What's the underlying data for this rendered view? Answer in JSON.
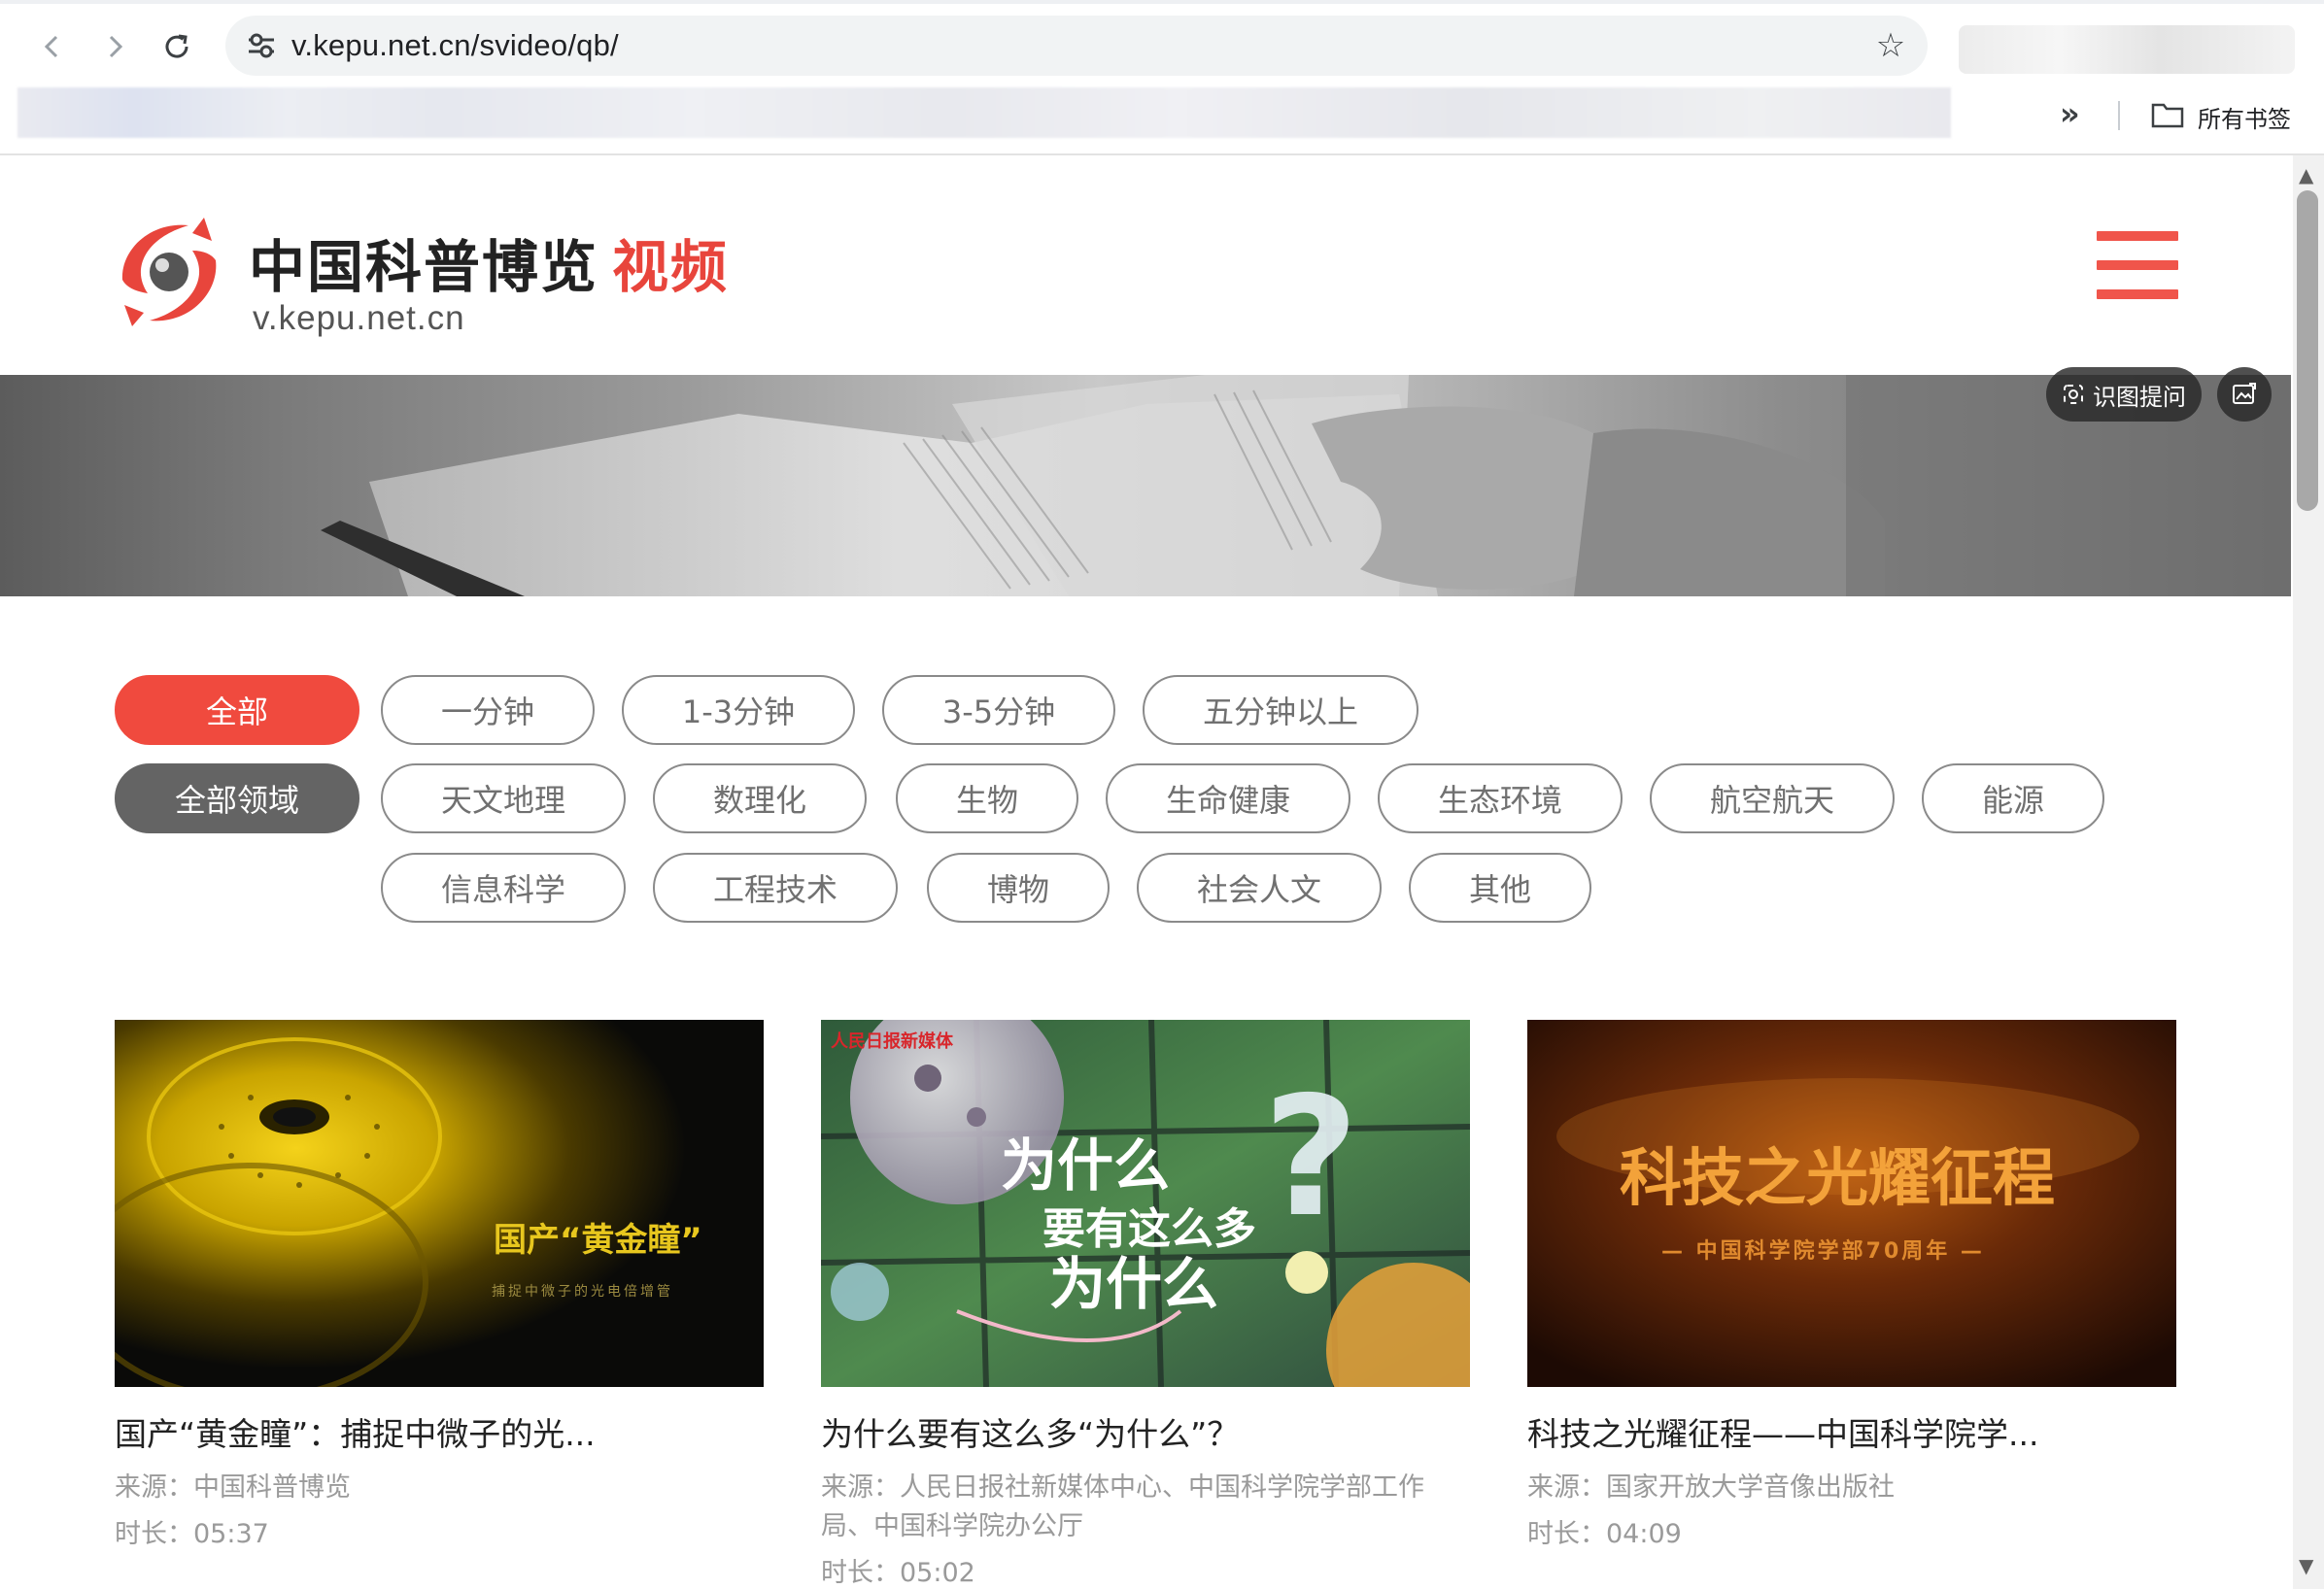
{
  "browser": {
    "url": "v.kepu.net.cn/svideo/qb/",
    "all_bookmarks": "所有书签",
    "more_bookmarks": "»"
  },
  "site": {
    "title": "中国科普博览",
    "title_highlight": "视频",
    "domain": "v.kepu.net.cn",
    "brand_color": "#e8453c"
  },
  "banner": {
    "lens_label": "识图提问"
  },
  "filters": {
    "duration": [
      "全部",
      "一分钟",
      "1-3分钟",
      "3-5分钟",
      "五分钟以上"
    ],
    "domain_row1": [
      "全部领域",
      "天文地理",
      "数理化",
      "生物",
      "生命健康",
      "生态环境",
      "航空航天",
      "能源"
    ],
    "domain_row2": [
      "信息科学",
      "工程技术",
      "博物",
      "社会人文",
      "其他"
    ]
  },
  "videos": [
    {
      "title": "国产“黄金瞳”：捕捉中微子的光...",
      "source": "来源：中国科普博览",
      "duration": "时长：05:37",
      "thumb_title": "国产“黄金瞳”",
      "thumb_sub": "捕捉中微子的光电倍增管"
    },
    {
      "title": "为什么要有这么多“为什么”？",
      "source": "来源：人民日报社新媒体中心、中国科学院学部工作局、中国科学院办公厅",
      "duration": "时长：05:02",
      "thumb_badge": "人民日报新媒体",
      "thumb_line1": "为什么",
      "thumb_line2": "要有这么多",
      "thumb_line3": "为什么"
    },
    {
      "title": "科技之光耀征程——中国科学院学...",
      "source": "来源：国家开放大学音像出版社",
      "duration": "时长：04:09",
      "thumb_title": "科技之光耀征程",
      "thumb_sub": "— 中国科学院学部70周年 —"
    }
  ]
}
